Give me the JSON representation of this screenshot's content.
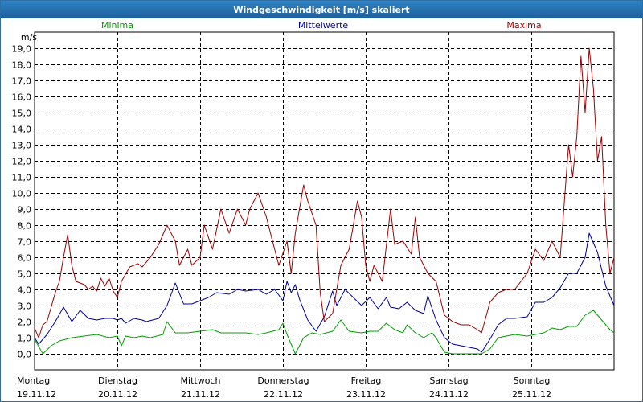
{
  "window": {
    "title": "Windgeschwindigkeit [m/s] skaliert"
  },
  "chart_data": {
    "type": "line",
    "title": "Windgeschwindigkeit [m/s] skaliert",
    "ylabel": "m/s",
    "xlabel": "",
    "ylim": [
      -1.0,
      20.0
    ],
    "xlim": [
      0,
      7
    ],
    "grid": true,
    "y_ticks": [
      "19,0",
      "18,0",
      "17,0",
      "16,0",
      "15,0",
      "14,0",
      "13,0",
      "12,0",
      "11,0",
      "10,0",
      "9,0",
      "8,0",
      "7,0",
      "6,0",
      "5,0",
      "4,0",
      "3,0",
      "2,0",
      "1,0",
      "0,0"
    ],
    "y_tick_values": [
      19,
      18,
      17,
      16,
      15,
      14,
      13,
      12,
      11,
      10,
      9,
      8,
      7,
      6,
      5,
      4,
      3,
      2,
      1,
      0
    ],
    "x_tick_labels": [
      {
        "day": "Montag",
        "date": "19.11.12"
      },
      {
        "day": "Dienstag",
        "date": "20.11.12"
      },
      {
        "day": "Mittwoch",
        "date": "21.11.12"
      },
      {
        "day": "Donnerstag",
        "date": "22.11.12"
      },
      {
        "day": "Freitag",
        "date": "23.11.12"
      },
      {
        "day": "Samstag",
        "date": "24.11.12"
      },
      {
        "day": "Sonntag",
        "date": "25.11.12"
      }
    ],
    "legend": [
      {
        "label": "Minima",
        "color": "#00a000",
        "position": "left"
      },
      {
        "label": "Mittelwerte",
        "color": "#0000a0",
        "position": "center"
      },
      {
        "label": "Maxima",
        "color": "#a00000",
        "position": "right"
      }
    ],
    "series": [
      {
        "name": "Minima",
        "color": "#00a000",
        "points": [
          [
            0,
            0.9
          ],
          [
            0.1,
            0.0
          ],
          [
            0.2,
            0.5
          ],
          [
            0.3,
            0.8
          ],
          [
            0.45,
            1.0
          ],
          [
            0.6,
            1.1
          ],
          [
            0.75,
            1.2
          ],
          [
            0.9,
            1.0
          ],
          [
            1.0,
            1.1
          ],
          [
            1.05,
            0.5
          ],
          [
            1.1,
            1.1
          ],
          [
            1.2,
            1.0
          ],
          [
            1.3,
            1.1
          ],
          [
            1.4,
            1.0
          ],
          [
            1.55,
            1.2
          ],
          [
            1.6,
            2.0
          ],
          [
            1.7,
            1.3
          ],
          [
            1.85,
            1.3
          ],
          [
            2.0,
            1.4
          ],
          [
            2.15,
            1.5
          ],
          [
            2.25,
            1.3
          ],
          [
            2.45,
            1.3
          ],
          [
            2.55,
            1.3
          ],
          [
            2.7,
            1.2
          ],
          [
            2.8,
            1.3
          ],
          [
            2.95,
            1.5
          ],
          [
            3.0,
            1.9
          ],
          [
            3.05,
            1.2
          ],
          [
            3.15,
            0.0
          ],
          [
            3.25,
            1.0
          ],
          [
            3.35,
            1.3
          ],
          [
            3.45,
            1.2
          ],
          [
            3.6,
            1.4
          ],
          [
            3.7,
            2.1
          ],
          [
            3.8,
            1.4
          ],
          [
            3.95,
            1.3
          ],
          [
            4.05,
            1.4
          ],
          [
            4.15,
            1.4
          ],
          [
            4.25,
            1.9
          ],
          [
            4.35,
            1.5
          ],
          [
            4.45,
            1.3
          ],
          [
            4.5,
            1.8
          ],
          [
            4.6,
            1.3
          ],
          [
            4.7,
            1.0
          ],
          [
            4.8,
            1.3
          ],
          [
            4.85,
            1.0
          ],
          [
            4.95,
            0.1
          ],
          [
            5.05,
            0.0
          ],
          [
            5.15,
            0.0
          ],
          [
            5.25,
            0.0
          ],
          [
            5.4,
            0.0
          ],
          [
            5.5,
            0.3
          ],
          [
            5.6,
            1.0
          ],
          [
            5.7,
            1.1
          ],
          [
            5.8,
            1.2
          ],
          [
            5.95,
            1.1
          ],
          [
            6.05,
            1.2
          ],
          [
            6.15,
            1.3
          ],
          [
            6.25,
            1.6
          ],
          [
            6.35,
            1.5
          ],
          [
            6.45,
            1.7
          ],
          [
            6.55,
            1.7
          ],
          [
            6.65,
            2.4
          ],
          [
            6.75,
            2.7
          ],
          [
            6.8,
            2.4
          ],
          [
            6.95,
            1.5
          ],
          [
            7.0,
            1.3
          ]
        ]
      },
      {
        "name": "Mittelwerte",
        "color": "#0000a0",
        "points": [
          [
            0,
            1.0
          ],
          [
            0.05,
            0.6
          ],
          [
            0.15,
            1.2
          ],
          [
            0.25,
            2.0
          ],
          [
            0.35,
            2.9
          ],
          [
            0.45,
            2.0
          ],
          [
            0.55,
            2.7
          ],
          [
            0.65,
            2.2
          ],
          [
            0.75,
            2.1
          ],
          [
            0.85,
            2.2
          ],
          [
            0.95,
            2.2
          ],
          [
            1.0,
            2.1
          ],
          [
            1.05,
            2.2
          ],
          [
            1.1,
            1.9
          ],
          [
            1.2,
            2.2
          ],
          [
            1.3,
            2.1
          ],
          [
            1.35,
            2.0
          ],
          [
            1.5,
            2.2
          ],
          [
            1.6,
            3.0
          ],
          [
            1.7,
            4.4
          ],
          [
            1.8,
            3.1
          ],
          [
            1.9,
            3.1
          ],
          [
            2.0,
            3.3
          ],
          [
            2.1,
            3.5
          ],
          [
            2.2,
            3.8
          ],
          [
            2.35,
            3.7
          ],
          [
            2.45,
            4.0
          ],
          [
            2.55,
            3.9
          ],
          [
            2.7,
            4.0
          ],
          [
            2.8,
            3.7
          ],
          [
            2.9,
            4.0
          ],
          [
            3.0,
            3.3
          ],
          [
            3.05,
            4.5
          ],
          [
            3.1,
            3.8
          ],
          [
            3.15,
            4.3
          ],
          [
            3.2,
            3.4
          ],
          [
            3.3,
            2.1
          ],
          [
            3.4,
            1.4
          ],
          [
            3.5,
            2.3
          ],
          [
            3.6,
            3.9
          ],
          [
            3.65,
            3.0
          ],
          [
            3.75,
            4.0
          ],
          [
            3.85,
            3.5
          ],
          [
            3.95,
            3.0
          ],
          [
            4.05,
            3.5
          ],
          [
            4.15,
            2.8
          ],
          [
            4.25,
            3.5
          ],
          [
            4.3,
            2.9
          ],
          [
            4.4,
            2.8
          ],
          [
            4.5,
            3.2
          ],
          [
            4.6,
            2.7
          ],
          [
            4.7,
            2.5
          ],
          [
            4.75,
            3.6
          ],
          [
            4.85,
            2.1
          ],
          [
            4.95,
            1.0
          ],
          [
            5.05,
            0.6
          ],
          [
            5.15,
            0.5
          ],
          [
            5.25,
            0.4
          ],
          [
            5.35,
            0.3
          ],
          [
            5.4,
            0.1
          ],
          [
            5.5,
            0.9
          ],
          [
            5.6,
            1.8
          ],
          [
            5.7,
            2.2
          ],
          [
            5.8,
            2.2
          ],
          [
            5.95,
            2.3
          ],
          [
            6.05,
            3.2
          ],
          [
            6.15,
            3.2
          ],
          [
            6.25,
            3.5
          ],
          [
            6.35,
            4.1
          ],
          [
            6.45,
            5.0
          ],
          [
            6.55,
            5.0
          ],
          [
            6.65,
            6.0
          ],
          [
            6.7,
            7.5
          ],
          [
            6.8,
            6.3
          ],
          [
            6.9,
            4.2
          ],
          [
            7.0,
            3.0
          ]
        ]
      },
      {
        "name": "Maxima",
        "color": "#a00000",
        "points": [
          [
            0,
            1.6
          ],
          [
            0.05,
            1.0
          ],
          [
            0.1,
            1.8
          ],
          [
            0.15,
            2.0
          ],
          [
            0.25,
            3.8
          ],
          [
            0.3,
            4.5
          ],
          [
            0.35,
            6.0
          ],
          [
            0.4,
            7.4
          ],
          [
            0.45,
            5.5
          ],
          [
            0.5,
            4.5
          ],
          [
            0.6,
            4.3
          ],
          [
            0.65,
            4.0
          ],
          [
            0.7,
            4.2
          ],
          [
            0.75,
            3.9
          ],
          [
            0.8,
            4.7
          ],
          [
            0.85,
            4.2
          ],
          [
            0.9,
            4.7
          ],
          [
            0.95,
            3.9
          ],
          [
            1.0,
            3.5
          ],
          [
            1.05,
            4.5
          ],
          [
            1.15,
            5.4
          ],
          [
            1.25,
            5.6
          ],
          [
            1.3,
            5.4
          ],
          [
            1.4,
            6.0
          ],
          [
            1.5,
            6.8
          ],
          [
            1.6,
            8.0
          ],
          [
            1.7,
            7.0
          ],
          [
            1.75,
            5.5
          ],
          [
            1.85,
            6.5
          ],
          [
            1.9,
            5.5
          ],
          [
            2.0,
            6.0
          ],
          [
            2.05,
            8.0
          ],
          [
            2.15,
            6.5
          ],
          [
            2.25,
            9.0
          ],
          [
            2.35,
            7.5
          ],
          [
            2.45,
            9.0
          ],
          [
            2.55,
            8.0
          ],
          [
            2.6,
            9.0
          ],
          [
            2.7,
            10.0
          ],
          [
            2.8,
            8.5
          ],
          [
            2.9,
            6.5
          ],
          [
            2.95,
            5.5
          ],
          [
            3.05,
            7.0
          ],
          [
            3.1,
            5.0
          ],
          [
            3.15,
            7.5
          ],
          [
            3.25,
            10.5
          ],
          [
            3.3,
            9.5
          ],
          [
            3.4,
            8.0
          ],
          [
            3.45,
            3.8
          ],
          [
            3.5,
            2.0
          ],
          [
            3.6,
            2.5
          ],
          [
            3.7,
            5.5
          ],
          [
            3.8,
            6.5
          ],
          [
            3.85,
            8.0
          ],
          [
            3.9,
            9.5
          ],
          [
            3.95,
            8.5
          ],
          [
            4.0,
            5.5
          ],
          [
            4.05,
            4.5
          ],
          [
            4.1,
            5.5
          ],
          [
            4.2,
            4.5
          ],
          [
            4.3,
            9.0
          ],
          [
            4.35,
            6.8
          ],
          [
            4.45,
            7.0
          ],
          [
            4.55,
            6.2
          ],
          [
            4.6,
            8.5
          ],
          [
            4.65,
            6.0
          ],
          [
            4.75,
            5.0
          ],
          [
            4.85,
            4.5
          ],
          [
            4.95,
            2.4
          ],
          [
            5.05,
            2.0
          ],
          [
            5.15,
            1.8
          ],
          [
            5.25,
            1.8
          ],
          [
            5.35,
            1.5
          ],
          [
            5.4,
            1.3
          ],
          [
            5.5,
            3.2
          ],
          [
            5.6,
            3.8
          ],
          [
            5.7,
            4.0
          ],
          [
            5.8,
            4.0
          ],
          [
            5.95,
            5.0
          ],
          [
            6.05,
            6.5
          ],
          [
            6.15,
            5.8
          ],
          [
            6.25,
            7.0
          ],
          [
            6.35,
            6.0
          ],
          [
            6.45,
            13.0
          ],
          [
            6.5,
            11.0
          ],
          [
            6.55,
            13.5
          ],
          [
            6.6,
            18.5
          ],
          [
            6.65,
            15.0
          ],
          [
            6.7,
            19.0
          ],
          [
            6.75,
            16.5
          ],
          [
            6.8,
            12.0
          ],
          [
            6.85,
            13.5
          ],
          [
            6.9,
            8.0
          ],
          [
            6.95,
            5.0
          ],
          [
            7.0,
            6.0
          ]
        ]
      }
    ]
  }
}
